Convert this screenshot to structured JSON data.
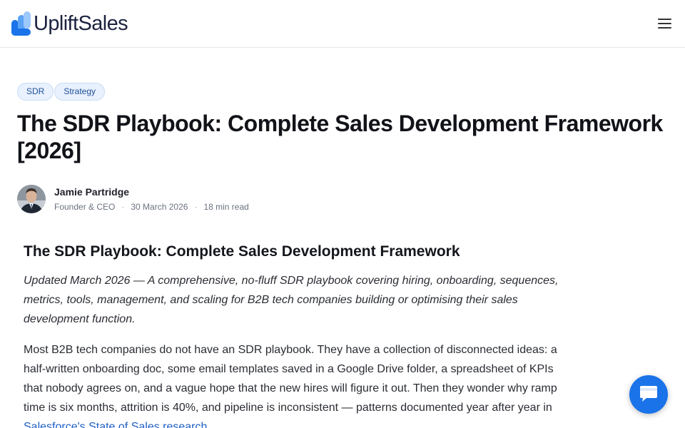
{
  "header": {
    "logo_text": "UpliftSales",
    "logo_colors": [
      "#1a73e8",
      "#5aa3f5",
      "#9cc8fa"
    ],
    "menu_icon": "hamburger-menu-icon"
  },
  "article": {
    "tags": [
      "SDR",
      "Strategy"
    ],
    "title": "The SDR Playbook: Complete Sales Development Framework [2026]",
    "author": {
      "name": "Jamie Partridge",
      "role": "Founder & CEO",
      "date": "30 March 2026",
      "read_time": "18 min read"
    },
    "heading": "The SDR Playbook: Complete Sales Development Framework",
    "lede": "Updated March 2026 — A comprehensive, no-fluff SDR playbook covering hiring, onboarding, sequences, metrics, tools, management, and scaling for B2B tech companies building or optimising their sales development function.",
    "body_intro": "Most B2B tech companies do not have an SDR playbook. They have a collection of disconnected ideas: a half-written onboarding doc, some email templates saved in a Google Drive folder, a spreadsheet of KPIs that nobody agrees on, and a vague hope that the new hires will figure it out. Then they wonder why ramp time is six months, attrition is 40%, and pipeline is inconsistent — patterns documented year after year in ",
    "body_link": "Salesforce's State of Sales research",
    "body_end": "."
  },
  "chat": {
    "icon": "chat-bubble-icon",
    "color": "#1a73e8"
  }
}
